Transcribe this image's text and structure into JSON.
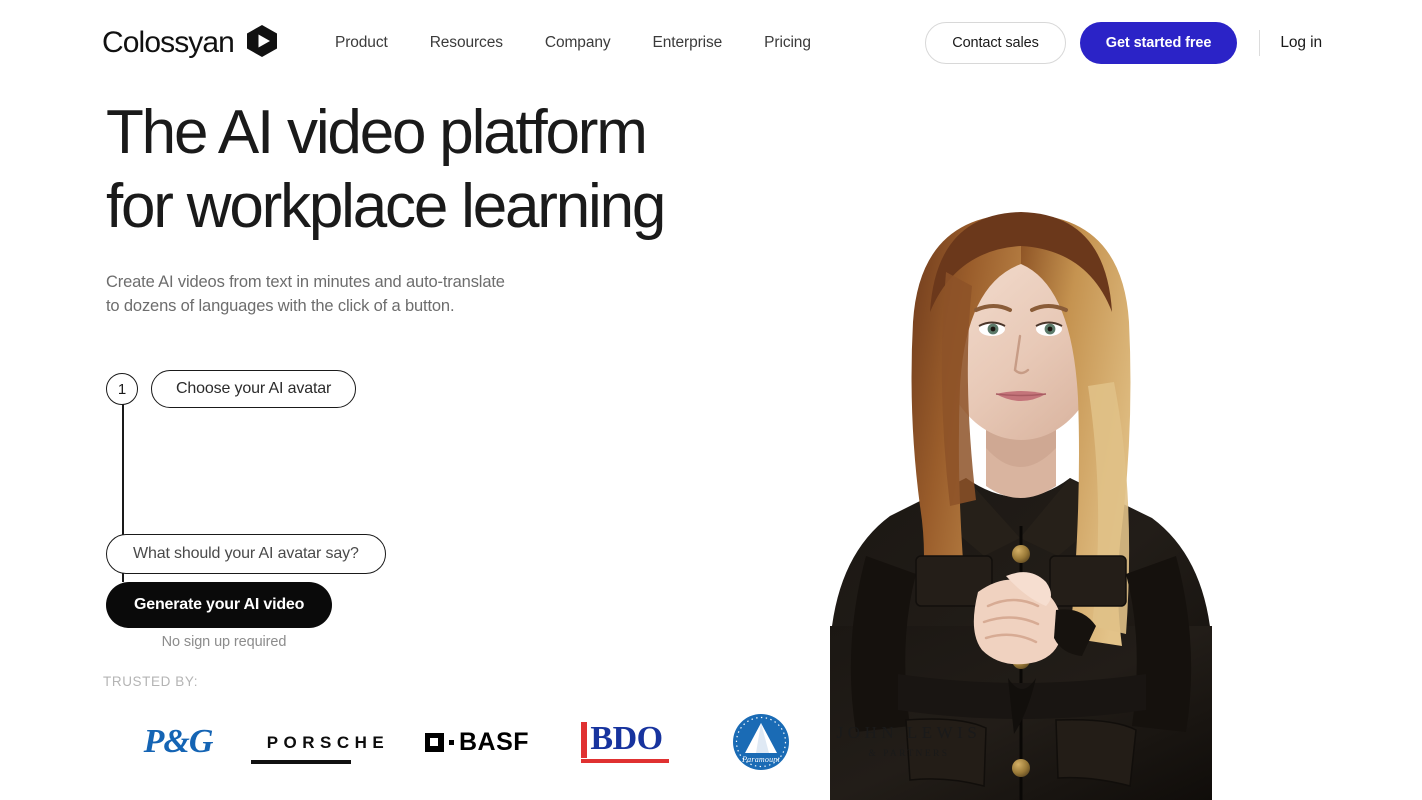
{
  "brand": {
    "name": "Colossyan",
    "mark_icon": "hexagon-play-icon"
  },
  "nav": {
    "items": [
      {
        "label": "Product"
      },
      {
        "label": "Resources"
      },
      {
        "label": "Company"
      },
      {
        "label": "Enterprise"
      },
      {
        "label": "Pricing"
      }
    ]
  },
  "header_actions": {
    "contact_sales": "Contact sales",
    "get_started": "Get started free",
    "login": "Log in",
    "accent_color": "#2b23c7"
  },
  "hero": {
    "headline": "The AI video platform\nfor workplace learning",
    "subhead": "Create AI videos from text in minutes and auto-translate\nto dozens of languages with the click of a button.",
    "image_alt": "AI avatar presenter, woman with long reddish-blonde hair wearing a black belted jacket, hands clasped"
  },
  "widget": {
    "step_number": "1",
    "step_label": "Choose your AI avatar",
    "script_placeholder": "What should your AI avatar say?",
    "generate_label": "Generate your AI video",
    "note": "No sign up required"
  },
  "trusted": {
    "label": "TRUSTED BY:",
    "logos": [
      {
        "name": "pg-logo",
        "text": "P&G",
        "color": "#1464b4"
      },
      {
        "name": "porsche-logo",
        "text": "PORSCHE",
        "color": "#0d0d0d"
      },
      {
        "name": "basf-logo",
        "text": "BASF",
        "color": "#000000"
      },
      {
        "name": "bdo-logo",
        "text": "BDO",
        "color": "#17339e",
        "accent": "#e03131"
      },
      {
        "name": "paramount-logo",
        "text": "Paramount",
        "color": "#1a6bb5"
      },
      {
        "name": "john-lewis-logo",
        "text": "JOHN LEWIS",
        "subtext": "& PARTNERS",
        "color": "#1a1a1a"
      }
    ]
  }
}
